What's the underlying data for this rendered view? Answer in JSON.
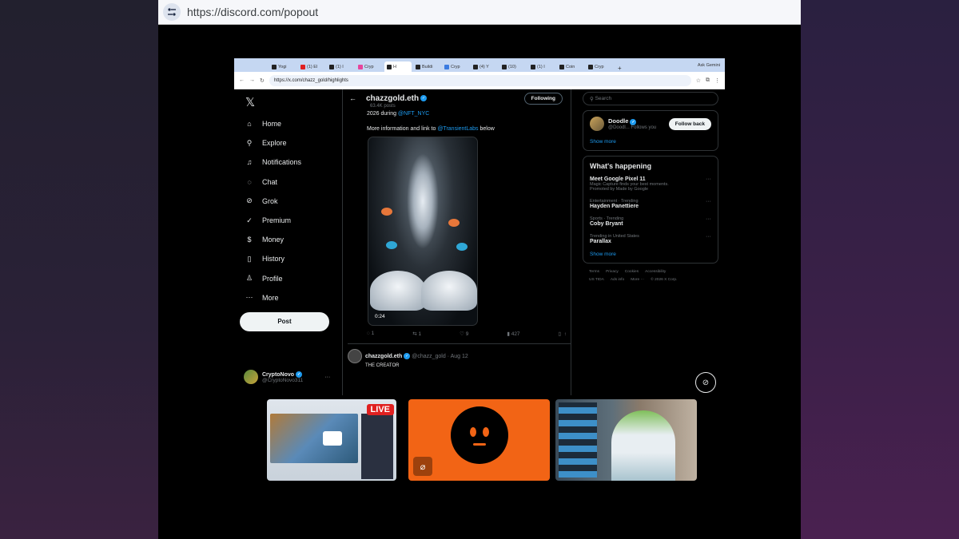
{
  "popout": {
    "url": "https://discord.com/popout"
  },
  "browser": {
    "tabs": [
      {
        "label": "Yogi",
        "fav": "dark"
      },
      {
        "label": "(1) El",
        "fav": "red"
      },
      {
        "label": "(1) I",
        "fav": "dark"
      },
      {
        "label": "Cryp",
        "fav": "pink"
      },
      {
        "label": "H",
        "fav": "dark",
        "active": true
      },
      {
        "label": "Buildi",
        "fav": "dark"
      },
      {
        "label": "Cryp",
        "fav": "blue"
      },
      {
        "label": "(4) Y",
        "fav": "dark"
      },
      {
        "label": "(10)",
        "fav": "dark"
      },
      {
        "label": "(1) I",
        "fav": "dark"
      },
      {
        "label": "Coin",
        "fav": "dark"
      },
      {
        "label": "Cryp",
        "fav": "dark"
      }
    ],
    "ask_gemini": "Ask Gemini",
    "url": "https://x.com/chazz_gold/highlights"
  },
  "x": {
    "nav": [
      {
        "label": "Home",
        "icon": "home-icon",
        "glyph": "⌂"
      },
      {
        "label": "Explore",
        "icon": "search-icon",
        "glyph": "⚲"
      },
      {
        "label": "Notifications",
        "icon": "bell-icon",
        "glyph": "♫"
      },
      {
        "label": "Chat",
        "icon": "chat-icon",
        "glyph": "◌"
      },
      {
        "label": "Grok",
        "icon": "grok-icon",
        "glyph": "⊘"
      },
      {
        "label": "Premium",
        "icon": "premium-icon",
        "glyph": "✓"
      },
      {
        "label": "Money",
        "icon": "money-icon",
        "glyph": "$"
      },
      {
        "label": "History",
        "icon": "bookmark-icon",
        "glyph": "▯"
      },
      {
        "label": "Profile",
        "icon": "profile-icon",
        "glyph": "♙"
      },
      {
        "label": "More",
        "icon": "more-icon",
        "glyph": "⋯"
      }
    ],
    "post_label": "Post",
    "me": {
      "name": "CryptoNovo",
      "handle": "@CryptoNovo311"
    },
    "profile": {
      "name": "chazzgold.eth",
      "posts": "63.4K posts",
      "following": "Following"
    },
    "tweet": {
      "line1_prefix": "2026 during ",
      "line1_link": "@NFT_NYC",
      "line2_prefix": "More information and link to ",
      "line2_link": "@TransientLabs",
      "line2_suffix": " below",
      "video_time": "0:24",
      "replies": "1",
      "reposts": "1",
      "likes": "9",
      "views": "427"
    },
    "reply": {
      "name": "chazzgold.eth",
      "handle": "@chazz_gold",
      "date": "Aug 12",
      "text": "THE CREATOR"
    },
    "search_placeholder": "Search",
    "suggestion": {
      "name": "Doodle",
      "handle": "@Doodl...",
      "follows_you": "Follows you",
      "button": "Follow back",
      "show_more": "Show more"
    },
    "happening": {
      "title": "What's happening",
      "items": [
        {
          "context": "",
          "title": "Meet Google Pixel 11",
          "sub": "Magic Capture finds your best moments.",
          "promo": "Promoted by Made by Google"
        },
        {
          "context": "Entertainment · Trending",
          "title": "Hayden Panettiere",
          "sub": "",
          "promo": ""
        },
        {
          "context": "Sports · Trending",
          "title": "Coby Bryant",
          "sub": "",
          "promo": ""
        },
        {
          "context": "Trending in United States",
          "title": "Parallax",
          "sub": "",
          "promo": ""
        }
      ],
      "show_more": "Show more"
    },
    "footer": [
      "Terms",
      "Privacy",
      "Cookies",
      "Accessibility",
      "US TIDA",
      "Ads info",
      "More ···",
      "© 2026 X Corp."
    ]
  },
  "tiles": {
    "live_label": "LIVE"
  }
}
